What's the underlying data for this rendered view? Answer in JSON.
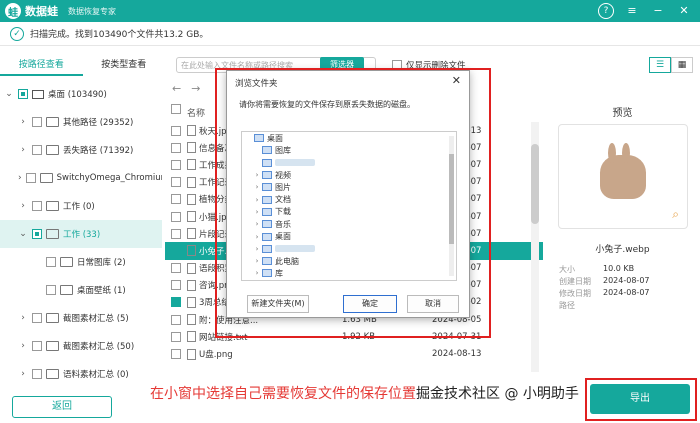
{
  "app": {
    "name": "数据蛙",
    "subtitle": "数据恢复专家",
    "logo_glyph": "蛙"
  },
  "window_controls": {
    "help": "?",
    "menu": "≡",
    "minimize": "−",
    "close": "✕"
  },
  "scan": {
    "status": "扫描完成。找到103490个文件共13.2 GB。"
  },
  "left_tabs": {
    "by_path": "按路径查看",
    "by_type": "按类型查看"
  },
  "tree": [
    {
      "label": "桌面 (103490)",
      "level": 0,
      "expanded": true,
      "state": "partial",
      "icon": "monitor-icon"
    },
    {
      "label": "其他路径 (29352)",
      "level": 1,
      "expanded": false,
      "state": "unchecked",
      "icon": "folder-icon"
    },
    {
      "label": "丢失路径 (71392)",
      "level": 1,
      "expanded": false,
      "state": "unchecked",
      "icon": "folder-icon"
    },
    {
      "label": "SwitchyOmega_Chromium",
      "level": 1,
      "expanded": false,
      "state": "unchecked",
      "icon": "folder-icon"
    },
    {
      "label": "工作 (0)",
      "level": 1,
      "expanded": false,
      "state": "unchecked",
      "icon": "folder-icon"
    },
    {
      "label": "工作 (33)",
      "level": 1,
      "expanded": true,
      "state": "partial",
      "icon": "folder-icon",
      "active": true
    },
    {
      "label": "日常图库 (2)",
      "level": 2,
      "expanded": false,
      "state": "unchecked",
      "icon": "folder-icon"
    },
    {
      "label": "桌面壁纸 (1)",
      "level": 2,
      "expanded": false,
      "state": "unchecked",
      "icon": "folder-icon"
    },
    {
      "label": "截图素材汇总 (5)",
      "level": 1,
      "expanded": false,
      "state": "unchecked",
      "icon": "folder-icon"
    },
    {
      "label": "截图素材汇总 (50)",
      "level": 1,
      "expanded": false,
      "state": "unchecked",
      "icon": "folder-icon"
    },
    {
      "label": "语料素材汇总 (0)",
      "level": 1,
      "expanded": false,
      "state": "unchecked",
      "icon": "folder-icon"
    }
  ],
  "toolbar": {
    "search_placeholder": "在此处输入文件名称或路径搜索",
    "filter_label": "筛选器",
    "only_deleted_label": "仅显示删除文件"
  },
  "list": {
    "headers": {
      "name": "名称",
      "size": "大小",
      "date": "修改日期"
    },
    "rows": [
      {
        "name": "秋天.jpg",
        "size": "",
        "date": "2024-08-13",
        "checked": false,
        "selected": false
      },
      {
        "name": "信息备忘",
        "size": "",
        "date": "2024-08-07",
        "checked": false,
        "selected": false
      },
      {
        "name": "工作成果分",
        "size": "",
        "date": "2024-08-07",
        "checked": false,
        "selected": false
      },
      {
        "name": "工作记录表",
        "size": "",
        "date": "2024-08-07",
        "checked": false,
        "selected": false
      },
      {
        "name": "植物分类.d",
        "size": "",
        "date": "2024-08-07",
        "checked": false,
        "selected": false
      },
      {
        "name": "小猫.jpg",
        "size": "",
        "date": "2024-08-07",
        "checked": false,
        "selected": false
      },
      {
        "name": "片段记录.d",
        "size": "",
        "date": "2024-08-07",
        "checked": false,
        "selected": false
      },
      {
        "name": "小兔子.we",
        "size": "",
        "date": "2024-08-07",
        "checked": true,
        "selected": true
      },
      {
        "name": "语段积累.d",
        "size": "",
        "date": "2024-08-07",
        "checked": false,
        "selected": false
      },
      {
        "name": "咨询.png",
        "size": "",
        "date": "2024-08-07",
        "checked": false,
        "selected": false
      },
      {
        "name": "3周总结.d",
        "size": "",
        "date": "2024-07-02",
        "checked": true,
        "selected": false
      },
      {
        "name": "附：使用注意...",
        "size": "1.63 MB",
        "date": "2024-08-05",
        "checked": false,
        "selected": false
      },
      {
        "name": "网站链接.txt",
        "size": "1.92 KB",
        "date": "2024-07-31",
        "checked": false,
        "selected": false
      },
      {
        "name": "U盘.png",
        "size": "",
        "date": "2024-08-13",
        "checked": false,
        "selected": false
      }
    ]
  },
  "preview": {
    "title": "预览",
    "file_name": "小兔子.webp",
    "meta": [
      {
        "key": "大小",
        "value": "10.0 KB"
      },
      {
        "key": "创建日期",
        "value": "2024-08-07"
      },
      {
        "key": "修改日期",
        "value": "2024-08-07"
      },
      {
        "key": "路径",
        "value": ""
      }
    ]
  },
  "dialog": {
    "title": "浏览文件夹",
    "close": "✕",
    "prompt": "请你将需要恢复的文件保存到原丢失数据的磁盘。",
    "nodes": [
      {
        "label": "桌面",
        "level": 0,
        "caret": ""
      },
      {
        "label": "图库",
        "level": 1,
        "caret": ""
      },
      {
        "label": "",
        "level": 1,
        "caret": "",
        "blurred": true
      },
      {
        "label": "视频",
        "level": 1,
        "caret": "›"
      },
      {
        "label": "图片",
        "level": 1,
        "caret": "›"
      },
      {
        "label": "文档",
        "level": 1,
        "caret": "›"
      },
      {
        "label": "下载",
        "level": 1,
        "caret": "›"
      },
      {
        "label": "音乐",
        "level": 1,
        "caret": "›"
      },
      {
        "label": "桌面",
        "level": 1,
        "caret": "›"
      },
      {
        "label": "",
        "level": 1,
        "caret": "›",
        "blurred": true
      },
      {
        "label": "此电脑",
        "level": 1,
        "caret": "›"
      },
      {
        "label": "库",
        "level": 1,
        "caret": "›"
      }
    ],
    "new_folder": "新建文件夹(M)",
    "ok": "确定",
    "cancel": "取消"
  },
  "bottom": {
    "back": "返回",
    "export": "导出"
  },
  "caption": "在小窗中选择自己需要恢复文件的保存位置",
  "watermark": "掘金技术社区 @ 小明助手",
  "colors": {
    "accent": "#15a89c",
    "highlight": "#e02020"
  }
}
